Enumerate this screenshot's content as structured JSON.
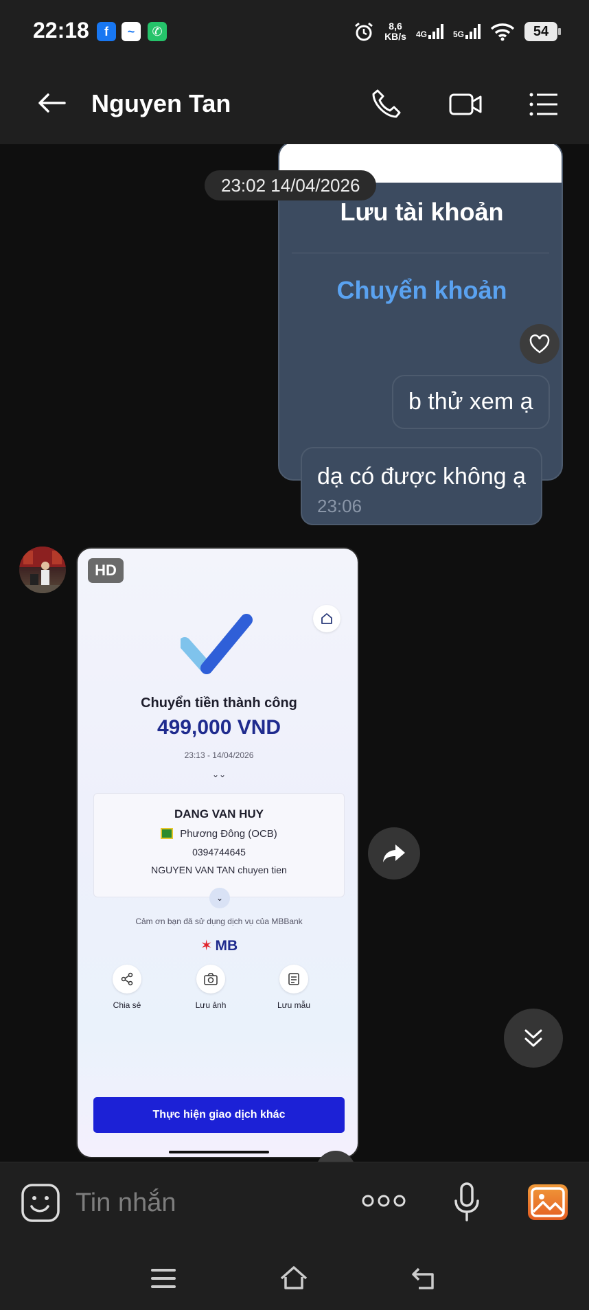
{
  "status_bar": {
    "time": "22:18",
    "speed_value": "8,6",
    "speed_unit": "KB/s",
    "network_1": "4G",
    "network_2": "5G",
    "battery": "54"
  },
  "header": {
    "contact_name": "Nguyen Tan"
  },
  "chat": {
    "account_card": {
      "save_account": "Lưu tài khoản",
      "transfer": "Chuyển khoản"
    },
    "date_separator": "23:02 14/04/2026",
    "messages": [
      {
        "text": "b thử xem ạ"
      },
      {
        "text": "dạ có được không ạ",
        "time": "23:06"
      }
    ],
    "receipt": {
      "hd_badge": "HD",
      "status": "Chuyển tiền thành công",
      "amount": "499,000 VND",
      "datetime": "23:13 - 14/04/2026",
      "recipient_name": "DANG VAN HUY",
      "bank": "Phương Đông (OCB)",
      "account_number": "0394744645",
      "note": "NGUYEN VAN TAN chuyen tien",
      "thanks": "Cảm ơn bạn đã sử dụng dịch vụ của MBBank",
      "brand": "MB",
      "actions": [
        "Chia sẻ",
        "Lưu ảnh",
        "Lưu mẫu"
      ],
      "cta": "Thực hiện giao dịch khác"
    }
  },
  "composer": {
    "placeholder": "Tin nhắn"
  },
  "colors": {
    "bubble": "#3c4b60",
    "link_blue": "#5aa2f0",
    "background": "#0f0f0f",
    "bar": "#1f1f1f"
  }
}
